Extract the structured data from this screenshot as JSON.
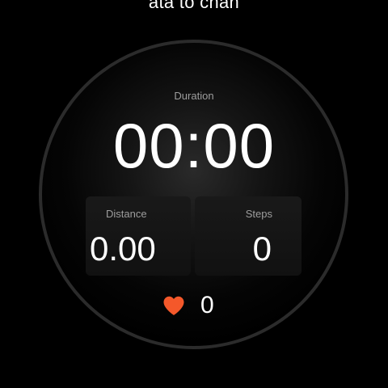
{
  "top_hint": "ata to chan",
  "duration": {
    "label": "Duration",
    "value": "00:00"
  },
  "distance": {
    "label": "Distance",
    "value": "0.00"
  },
  "steps": {
    "label": "Steps",
    "value": "0"
  },
  "heart_rate": {
    "icon": "heart-icon",
    "value": "0",
    "color": "#f4582a"
  },
  "colors": {
    "background": "#000000",
    "bezel": "#2b2b2b",
    "label": "#9e9e9e",
    "value": "#ffffff",
    "heart": "#f4582a"
  }
}
